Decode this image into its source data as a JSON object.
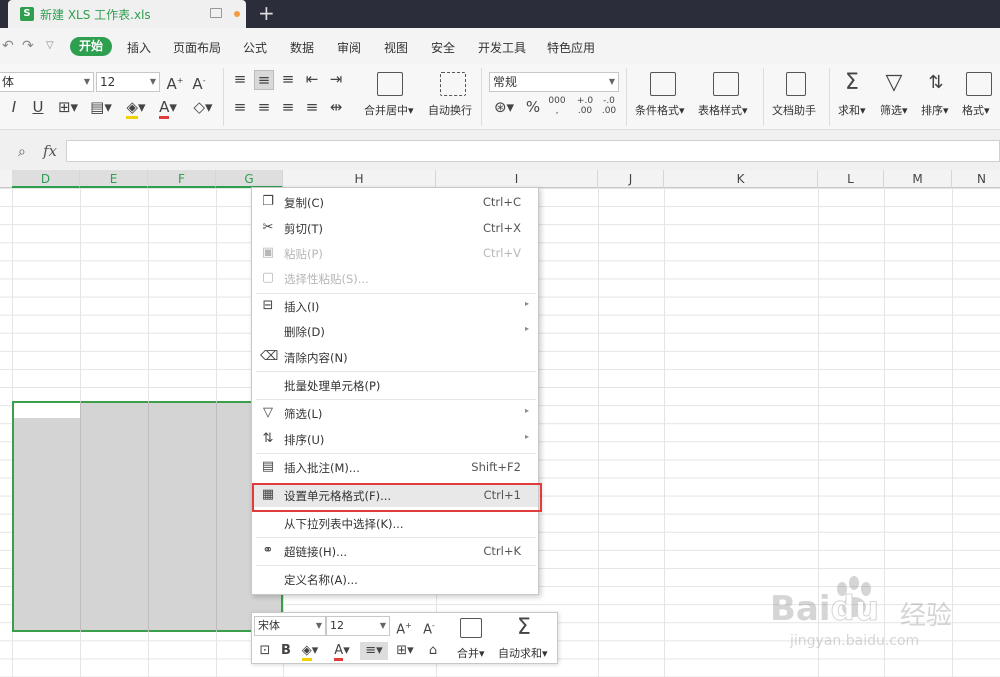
{
  "titlebar": {
    "doc_icon": "xls-icon",
    "doc_title": "新建 XLS 工作表.xls",
    "new_tab": "+"
  },
  "menubar": {
    "undo_icon": "undo-icon",
    "redo_icon": "redo-icon",
    "start": "开始",
    "items": [
      "插入",
      "页面布局",
      "公式",
      "数据",
      "审阅",
      "视图",
      "安全",
      "开发工具",
      "特色应用"
    ]
  },
  "ribbon": {
    "font_name": "体",
    "font_size": "12",
    "number_format": "常规",
    "merge_center": "合并居中",
    "wrap_text": "自动换行",
    "cond_format": "条件格式",
    "table_style": "表格样式",
    "doc_assistant": "文档助手",
    "sum": "求和",
    "filter": "筛选",
    "sort": "排序",
    "format": "格式",
    "percent": "%",
    "thousands": "000",
    "dec_inc": "+.0\n.00",
    "dec_dec": "-.0\n.00"
  },
  "formula_bar": {
    "fx": "fx",
    "value": ""
  },
  "columns": [
    "D",
    "E",
    "F",
    "G",
    "H",
    "I",
    "J",
    "K",
    "L",
    "M",
    "N"
  ],
  "context_menu": {
    "items": [
      {
        "label": "复制(C)",
        "shortcut": "Ctrl+C",
        "icon": "copy-icon",
        "disabled": false,
        "submenu": false
      },
      {
        "label": "剪切(T)",
        "shortcut": "Ctrl+X",
        "icon": "cut-icon",
        "disabled": false,
        "submenu": false
      },
      {
        "label": "粘贴(P)",
        "shortcut": "Ctrl+V",
        "icon": "paste-icon",
        "disabled": true,
        "submenu": false
      },
      {
        "label": "选择性粘贴(S)...",
        "shortcut": "",
        "icon": "paste-special-icon",
        "disabled": true,
        "submenu": false
      },
      {
        "label": "插入(I)",
        "shortcut": "",
        "icon": "insert-icon",
        "disabled": false,
        "submenu": true
      },
      {
        "label": "删除(D)",
        "shortcut": "",
        "icon": "",
        "disabled": false,
        "submenu": true
      },
      {
        "label": "清除内容(N)",
        "shortcut": "",
        "icon": "eraser-icon",
        "disabled": false,
        "submenu": false
      },
      {
        "label": "批量处理单元格(P)",
        "shortcut": "",
        "icon": "",
        "disabled": false,
        "submenu": false
      },
      {
        "label": "筛选(L)",
        "shortcut": "",
        "icon": "filter-icon",
        "disabled": false,
        "submenu": true
      },
      {
        "label": "排序(U)",
        "shortcut": "",
        "icon": "sort-icon",
        "disabled": false,
        "submenu": true
      },
      {
        "label": "插入批注(M)...",
        "shortcut": "Shift+F2",
        "icon": "comment-icon",
        "disabled": false,
        "submenu": false
      },
      {
        "label": "设置单元格格式(F)...",
        "shortcut": "Ctrl+1",
        "icon": "format-cells-icon",
        "disabled": false,
        "submenu": false
      },
      {
        "label": "从下拉列表中选择(K)...",
        "shortcut": "",
        "icon": "",
        "disabled": false,
        "submenu": false
      },
      {
        "label": "超链接(H)...",
        "shortcut": "Ctrl+K",
        "icon": "link-icon",
        "disabled": false,
        "submenu": false
      },
      {
        "label": "定义名称(A)...",
        "shortcut": "",
        "icon": "",
        "disabled": false,
        "submenu": false
      }
    ]
  },
  "mini_toolbar": {
    "font_name": "宋体",
    "font_size": "12",
    "merge": "合并",
    "autosum": "自动求和",
    "bold": "B"
  },
  "watermark": {
    "brand": "Bai",
    "brand2": "du",
    "cn": "经验",
    "url": "jingyan.baidu.com"
  },
  "colors": {
    "accent_green": "#2e9e4f",
    "highlight_red": "#e03c3c",
    "titlebar": "#2b2d3a"
  }
}
